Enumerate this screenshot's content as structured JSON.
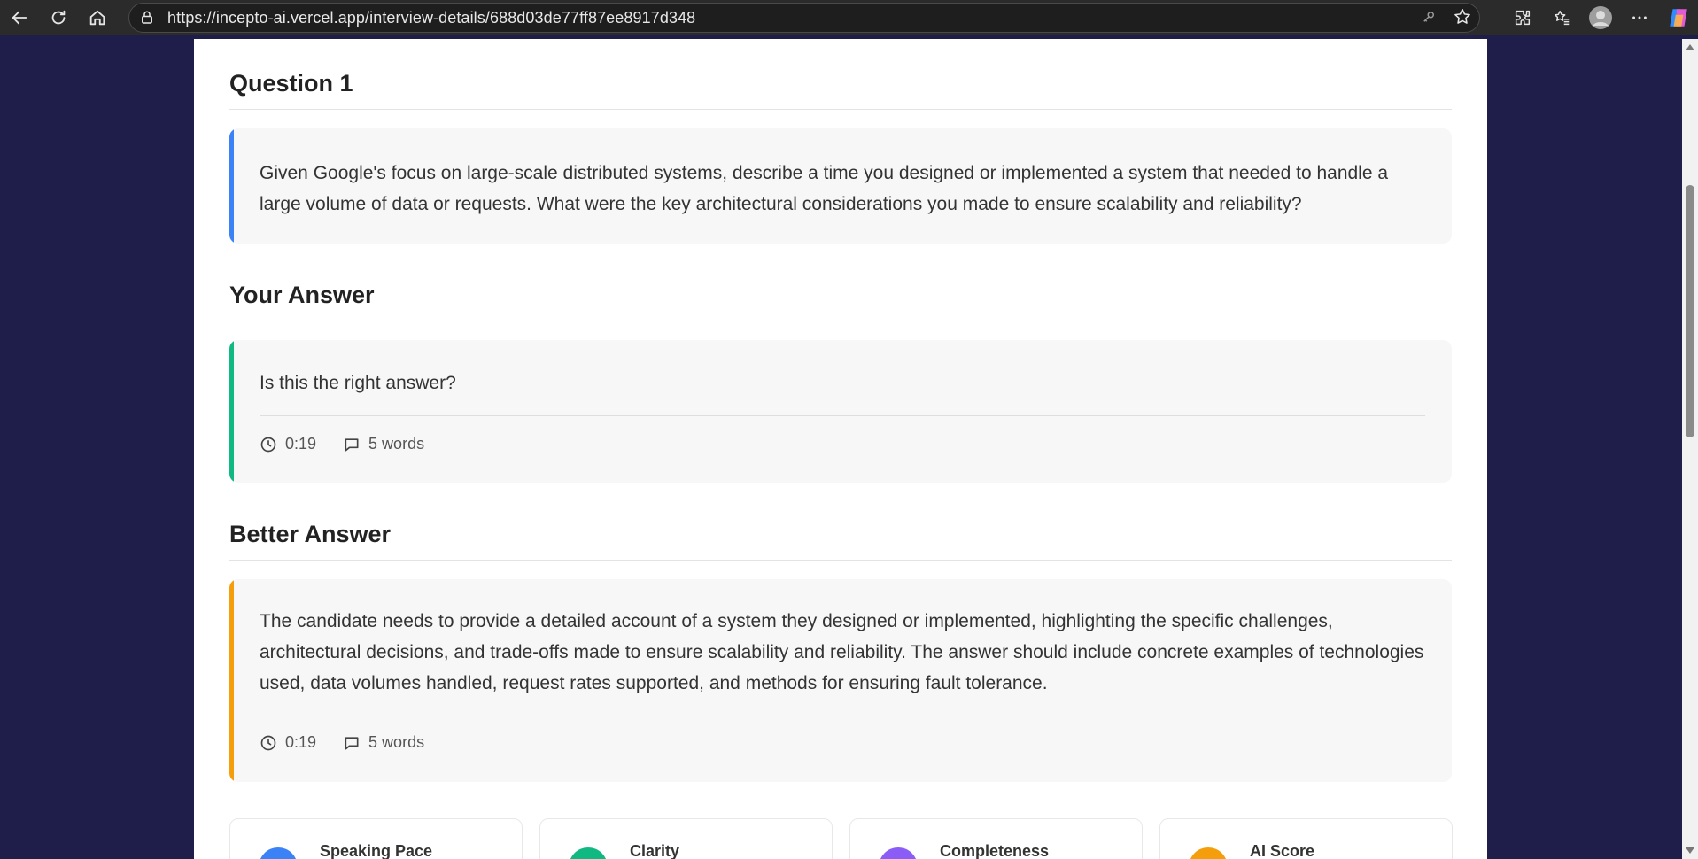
{
  "browser": {
    "url": "https://incepto-ai.vercel.app/interview-details/688d03de77ff87ee8917d348"
  },
  "question": {
    "heading": "Question 1",
    "text": "Given Google's focus on large-scale distributed systems, describe a time you designed or implemented a system that needed to handle a large volume of data or requests. What were the key architectural considerations you made to ensure scalability and reliability?",
    "accent": "#3b82f6"
  },
  "your_answer": {
    "heading": "Your Answer",
    "text": "Is this the right answer?",
    "duration": "0:19",
    "words": "5 words",
    "accent": "#10b981"
  },
  "better_answer": {
    "heading": "Better Answer",
    "text": "The candidate needs to provide a detailed account of a system they designed or implemented, highlighting the specific challenges, architectural decisions, and trade-offs made to ensure scalability and reliability. The answer should include concrete examples of technologies used, data volumes handled, request rates supported, and methods for ensuring fault tolerance.",
    "duration": "0:19",
    "words": "5 words",
    "accent": "#f59e0b"
  },
  "metrics": [
    {
      "label": "Speaking Pace",
      "color": "#3b82f6"
    },
    {
      "label": "Clarity",
      "color": "#10b981"
    },
    {
      "label": "Completeness",
      "color": "#8b5cf6"
    },
    {
      "label": "AI Score",
      "color": "#f59e0b"
    }
  ]
}
